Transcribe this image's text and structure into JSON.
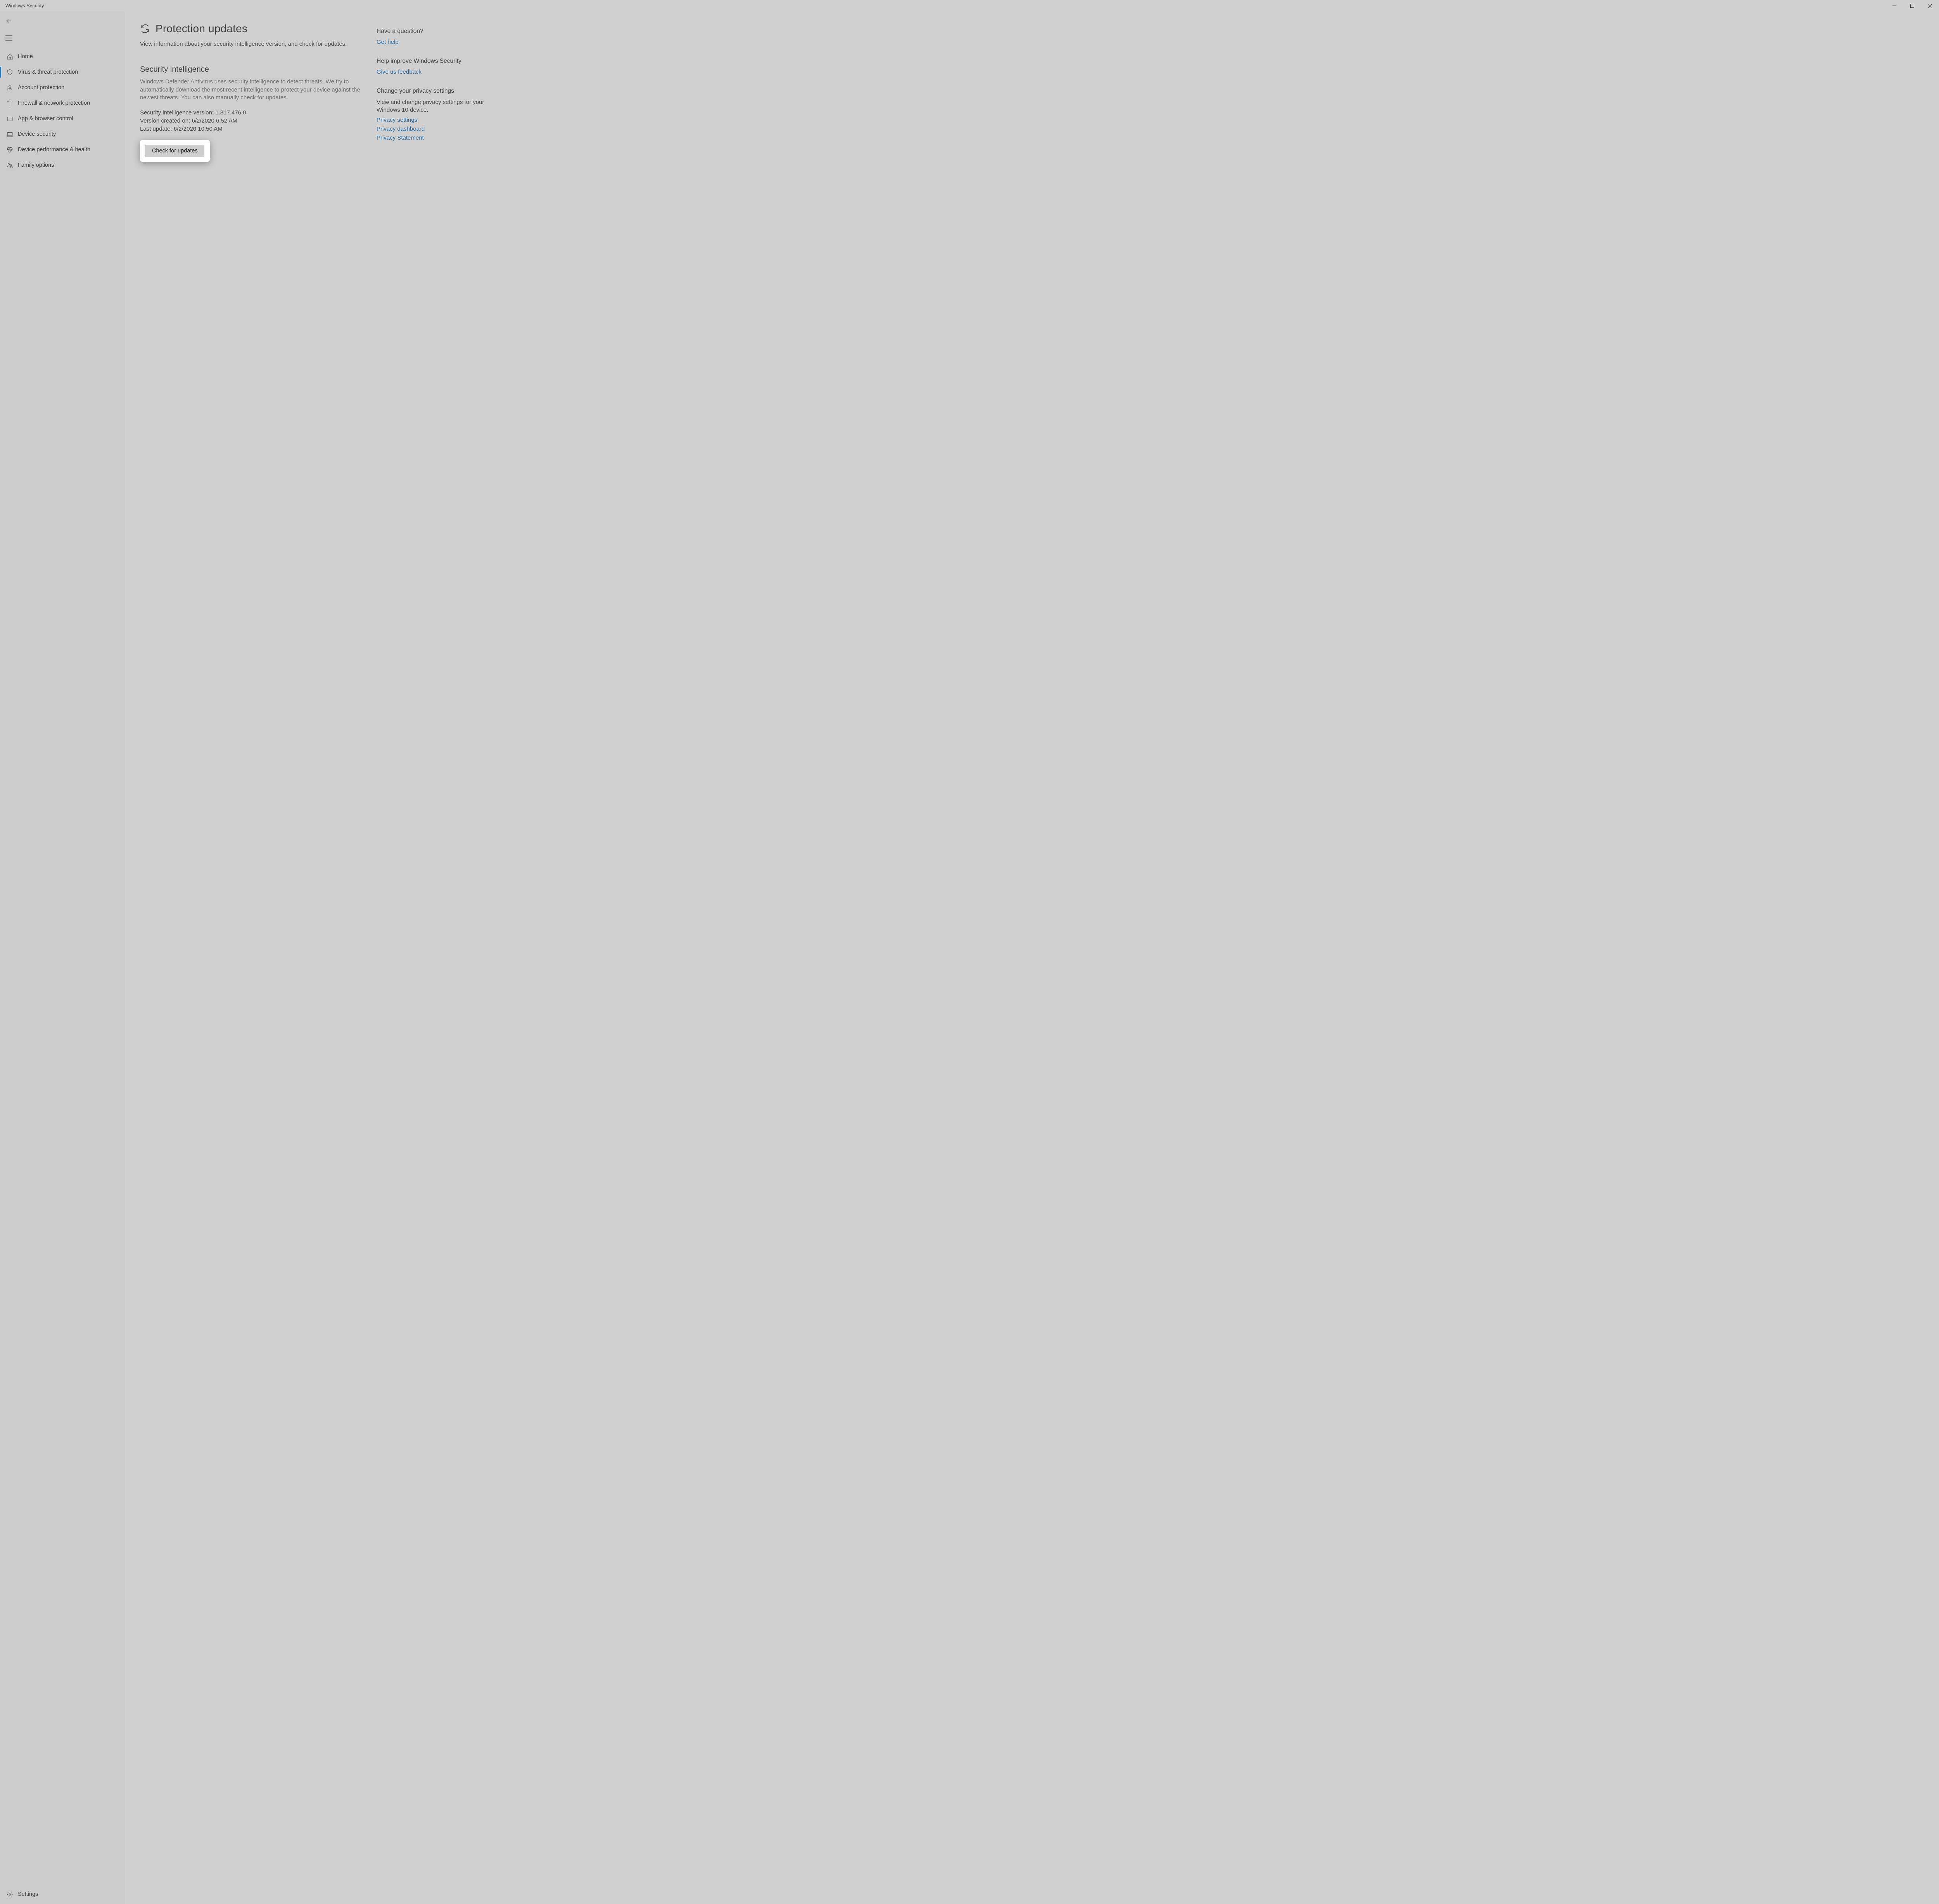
{
  "window": {
    "title": "Windows Security"
  },
  "sidebar": {
    "items": [
      {
        "label": "Home"
      },
      {
        "label": "Virus & threat protection"
      },
      {
        "label": "Account protection"
      },
      {
        "label": "Firewall & network protection"
      },
      {
        "label": "App & browser control"
      },
      {
        "label": "Device security"
      },
      {
        "label": "Device performance & health"
      },
      {
        "label": "Family options"
      }
    ],
    "settings_label": "Settings"
  },
  "main": {
    "title": "Protection updates",
    "subtitle": "View information about your security intelligence version, and check for updates.",
    "section_heading": "Security intelligence",
    "section_desc": "Windows Defender Antivirus uses security intelligence to detect threats. We try to automatically download the most recent intelligence to protect your device against the newest threats. You can also manually check for updates.",
    "version_label": "Security intelligence version:",
    "version_value": "1.317.476.0",
    "created_label": "Version created on:",
    "created_value": "6/2/2020 6:52 AM",
    "updated_label": "Last update:",
    "updated_value": "6/2/2020 10:50 AM",
    "check_button": "Check for updates"
  },
  "aside": {
    "question_heading": "Have a question?",
    "get_help": "Get help",
    "improve_heading": "Help improve Windows Security",
    "feedback": "Give us feedback",
    "privacy_heading": "Change your privacy settings",
    "privacy_desc": "View and change privacy settings for your Windows 10 device.",
    "privacy_settings": "Privacy settings",
    "privacy_dashboard": "Privacy dashboard",
    "privacy_statement": "Privacy Statement"
  }
}
